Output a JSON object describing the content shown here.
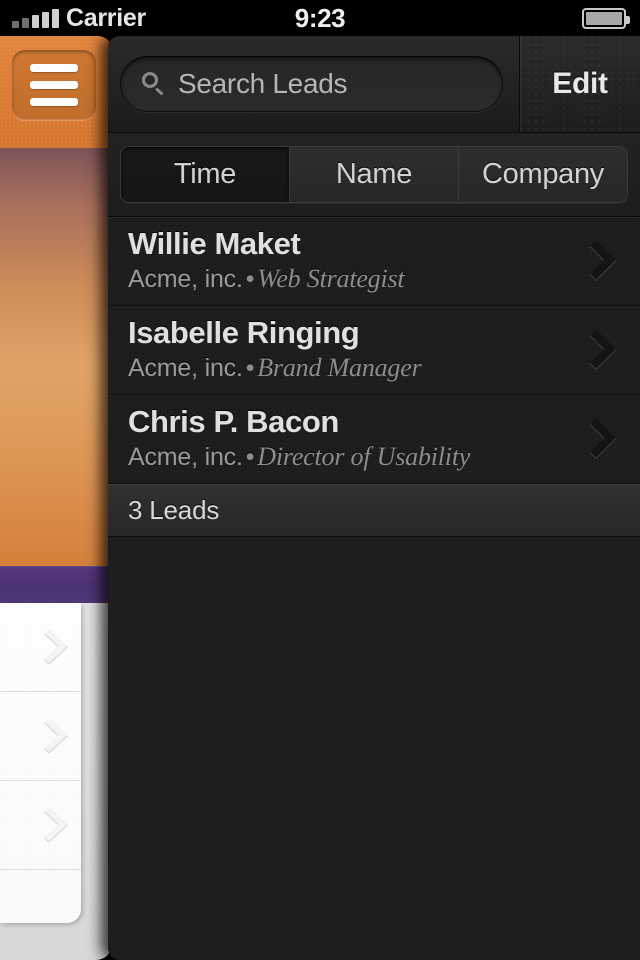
{
  "status_bar": {
    "carrier": "Carrier",
    "time": "9:23",
    "signal_icon": "signal-bars-icon",
    "battery_icon": "battery-icon"
  },
  "sidebar": {
    "menu_button_icon": "hamburger-menu-icon",
    "rows": [
      {
        "chevron_icon": "chevron-right-icon"
      },
      {
        "chevron_icon": "chevron-right-icon"
      },
      {
        "chevron_icon": "chevron-right-icon"
      }
    ],
    "colors": {
      "header_orange": "#dc7c34",
      "body_orange": "#e0a368",
      "accent_purple": "#4c3374",
      "card_white": "#fefefe"
    }
  },
  "toolbar": {
    "search_placeholder": "Search Leads",
    "search_value": "",
    "search_icon": "search-icon",
    "edit_label": "Edit"
  },
  "segmented_control": {
    "selected": "Time",
    "options": [
      {
        "label": "Time",
        "selected": true
      },
      {
        "label": "Name",
        "selected": false
      },
      {
        "label": "Company",
        "selected": false
      }
    ]
  },
  "leads": [
    {
      "name": "Willie Maket",
      "company": "Acme, inc.",
      "separator": "•",
      "title": "Web Strategist",
      "chevron_icon": "chevron-right-icon"
    },
    {
      "name": "Isabelle Ringing",
      "company": "Acme, inc.",
      "separator": "•",
      "title": "Brand Manager",
      "chevron_icon": "chevron-right-icon"
    },
    {
      "name": "Chris P. Bacon",
      "company": "Acme, inc.",
      "separator": "•",
      "title": "Director of Usability",
      "chevron_icon": "chevron-right-icon"
    }
  ],
  "footer": {
    "count_label": "3 Leads"
  }
}
